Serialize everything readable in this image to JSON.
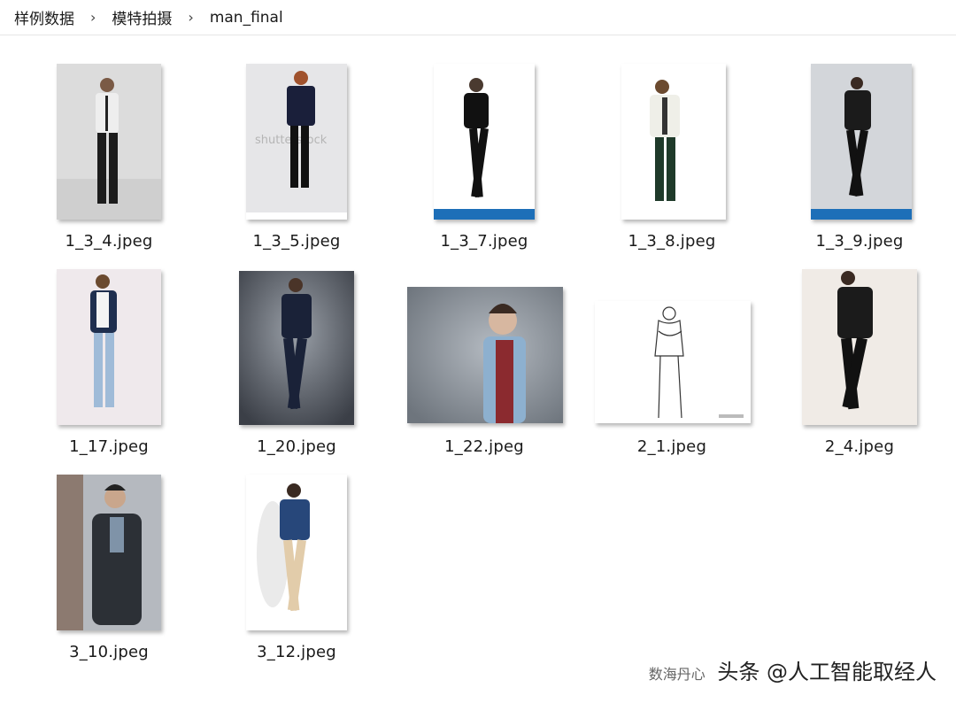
{
  "breadcrumb": {
    "items": [
      "样例数据",
      "模特拍摄",
      "man_final"
    ],
    "separator": "›"
  },
  "files": [
    {
      "name": "1_3_4.jpeg"
    },
    {
      "name": "1_3_5.jpeg"
    },
    {
      "name": "1_3_7.jpeg"
    },
    {
      "name": "1_3_8.jpeg"
    },
    {
      "name": "1_3_9.jpeg"
    },
    {
      "name": "1_17.jpeg"
    },
    {
      "name": "1_20.jpeg"
    },
    {
      "name": "1_22.jpeg"
    },
    {
      "name": "2_1.jpeg"
    },
    {
      "name": "2_4.jpeg"
    },
    {
      "name": "3_10.jpeg"
    },
    {
      "name": "3_12.jpeg"
    }
  ],
  "watermark": {
    "text": "头条 @人工智能取经人",
    "sub": "数海丹心"
  }
}
